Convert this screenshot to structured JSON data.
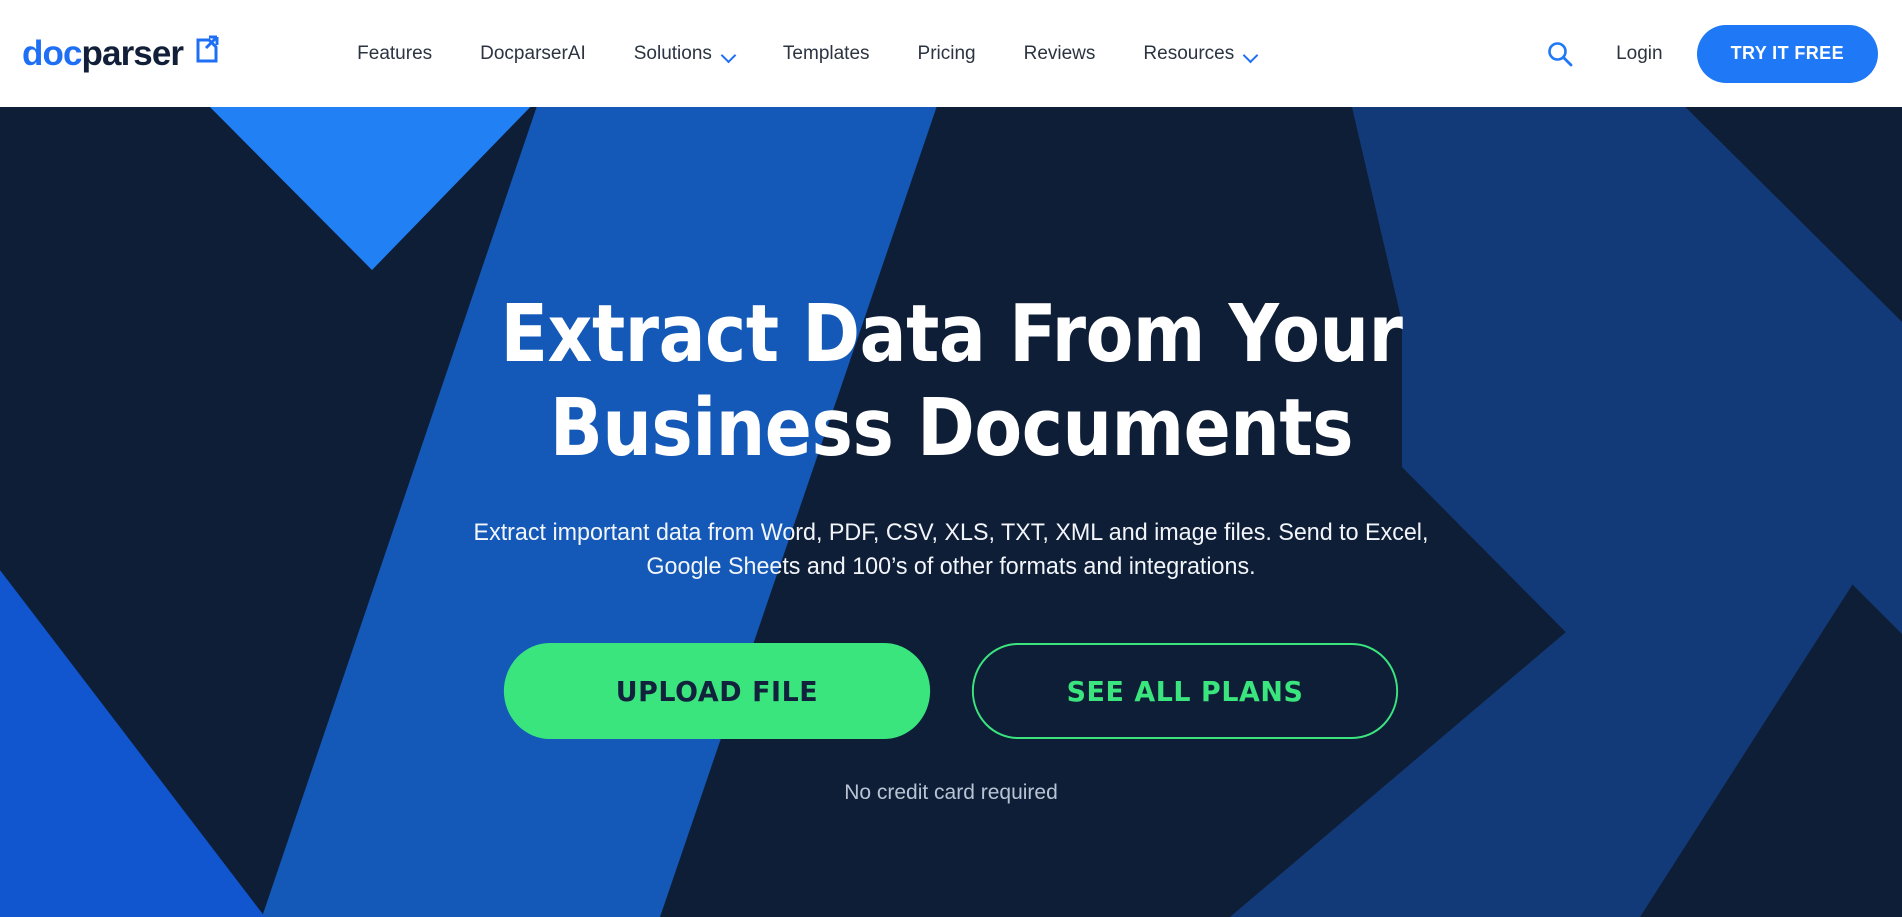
{
  "brand": {
    "name_part1": "doc",
    "name_part2": "parser",
    "logo_icon": "document-export-icon",
    "blue": "#1f6ff5",
    "navy": "#121f38"
  },
  "nav": {
    "items": [
      {
        "label": "Features",
        "has_dropdown": false
      },
      {
        "label": "DocparserAI",
        "has_dropdown": false
      },
      {
        "label": "Solutions",
        "has_dropdown": true
      },
      {
        "label": "Templates",
        "has_dropdown": false
      },
      {
        "label": "Pricing",
        "has_dropdown": false
      },
      {
        "label": "Reviews",
        "has_dropdown": false
      },
      {
        "label": "Resources",
        "has_dropdown": true
      }
    ],
    "search_icon": "search-icon",
    "login_label": "Login",
    "cta_label": "TRY IT FREE",
    "cta_color": "#1f78f5"
  },
  "hero": {
    "headline_line1": "Extract Data From Your",
    "headline_line2": "Business Documents",
    "subheading_line1": "Extract important data from Word, PDF, CSV, XLS, TXT, XML and image files. Send to Excel,",
    "subheading_line2": "Google Sheets and 100’s of other formats and integrations.",
    "primary_cta": "UPLOAD FILE",
    "secondary_cta": "SEE ALL PLANS",
    "note": "No credit card required",
    "bg_color": "#0f1e37",
    "accent_green": "#3ae57e",
    "accent_blue_bright": "#2280f5",
    "accent_blue_mid": "#1459b8",
    "accent_blue_dark": "#133a78"
  }
}
